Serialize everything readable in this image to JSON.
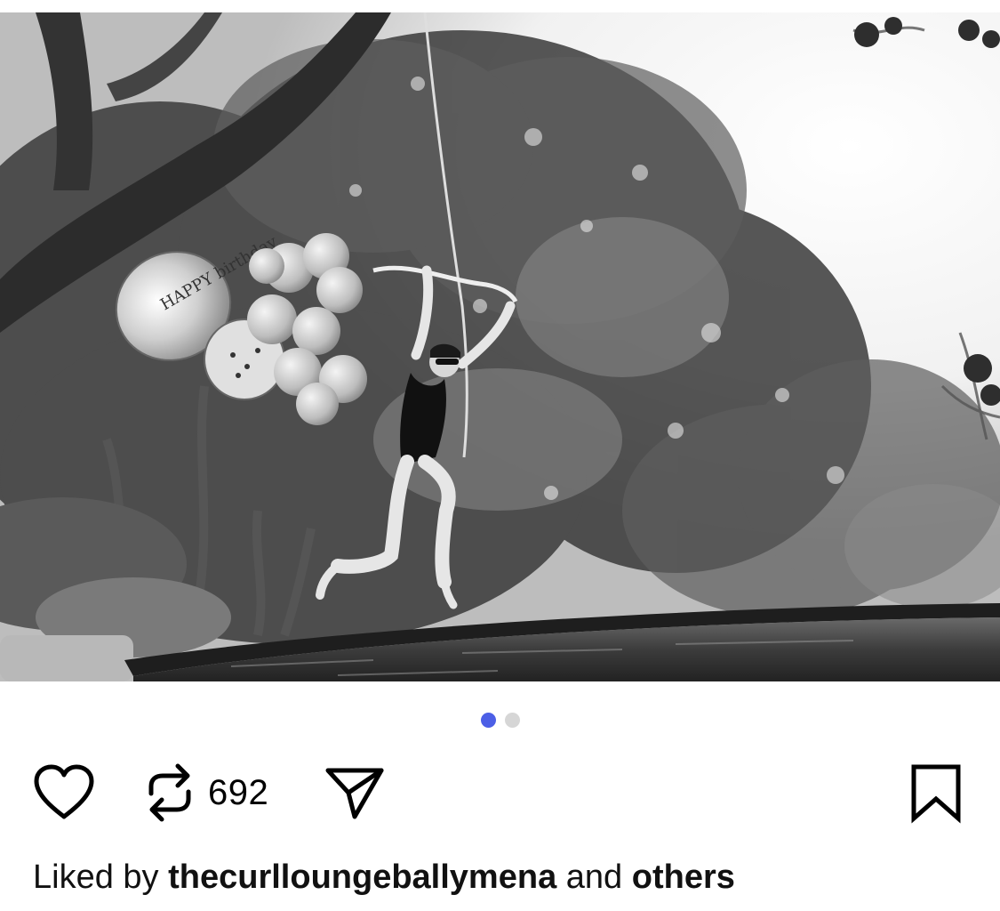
{
  "post": {
    "image_alt": "Black-and-white photo of a woman in a swimsuit swinging on a rope above a pool with balloons",
    "balloon_text": "HAPPY birthday",
    "carousel": {
      "total": 2,
      "active_index": 0,
      "active_color": "#4c5fe6",
      "inactive_color": "#d6d6d6"
    }
  },
  "actions": {
    "like_icon": "heart-icon",
    "repost_icon": "repost-icon",
    "repost_count": "692",
    "share_icon": "send-icon",
    "save_icon": "bookmark-icon"
  },
  "likes": {
    "prefix": "Liked by",
    "user": "thecurlloungeballymena",
    "middle": "and",
    "others": "others"
  }
}
